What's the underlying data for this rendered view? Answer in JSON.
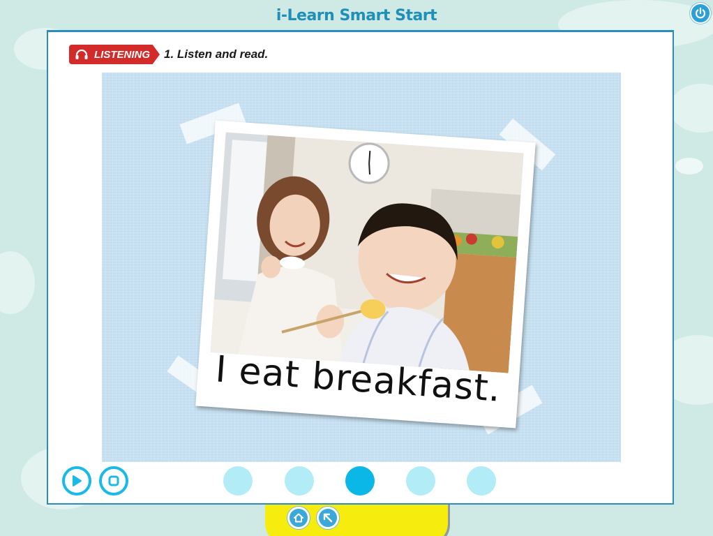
{
  "app": {
    "title": "i-Learn Smart Start"
  },
  "header": {
    "section_label": "LISTENING",
    "instruction": "1. Listen and read."
  },
  "content": {
    "caption": "I eat breakfast."
  },
  "controls": {
    "pages": [
      {
        "active": false
      },
      {
        "active": false
      },
      {
        "active": true
      },
      {
        "active": false
      },
      {
        "active": false
      }
    ]
  },
  "colors": {
    "accent": "#19b9e8",
    "dot_inactive": "#b2ecf7",
    "dot_active": "#0bb7e6",
    "badge": "#d32a2a",
    "title": "#1f8fb8",
    "tray": "#f6ec0e"
  },
  "icons": {
    "power": "power-icon",
    "play": "play-icon",
    "stop": "stop-icon",
    "home": "home-icon",
    "back": "back-arrow-icon",
    "listening": "headphones-icon"
  }
}
